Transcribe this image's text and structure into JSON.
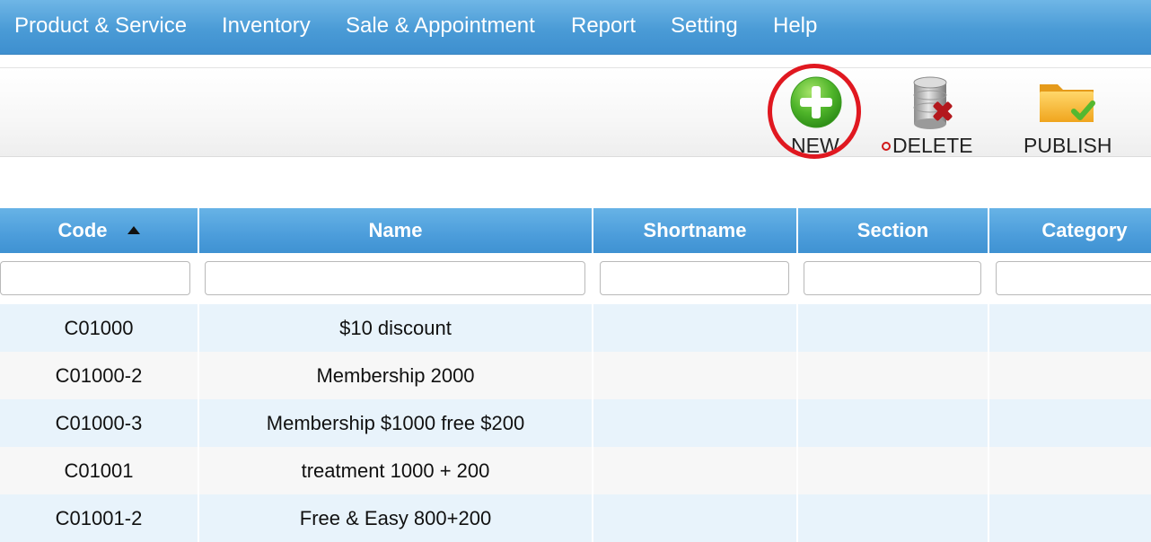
{
  "nav": {
    "items": [
      {
        "label": "Product & Service"
      },
      {
        "label": "Inventory"
      },
      {
        "label": "Sale & Appointment"
      },
      {
        "label": "Report"
      },
      {
        "label": "Setting"
      },
      {
        "label": "Help"
      }
    ]
  },
  "toolbar": {
    "new_label": "NEW",
    "delete_label": "DELETE",
    "publish_label": "PUBLISH"
  },
  "grid": {
    "columns": [
      {
        "label": "Code",
        "sorted": "ascending"
      },
      {
        "label": "Name"
      },
      {
        "label": "Shortname"
      },
      {
        "label": "Section"
      },
      {
        "label": "Category"
      }
    ],
    "rows": [
      {
        "code": "C01000",
        "name": "$10 discount",
        "shortname": "",
        "section": "",
        "category": ""
      },
      {
        "code": "C01000-2",
        "name": "Membership 2000",
        "shortname": "",
        "section": "",
        "category": ""
      },
      {
        "code": "C01000-3",
        "name": "Membership $1000 free $200",
        "shortname": "",
        "section": "",
        "category": ""
      },
      {
        "code": "C01001",
        "name": "treatment 1000 + 200",
        "shortname": "",
        "section": "",
        "category": ""
      },
      {
        "code": "C01001-2",
        "name": "Free & Easy 800+200",
        "shortname": "",
        "section": "",
        "category": ""
      }
    ]
  },
  "colors": {
    "nav_blue": "#4a9bd6",
    "header_blue": "#4c9ddb",
    "row_alt": "#e8f3fb",
    "highlight": "#e01820"
  }
}
